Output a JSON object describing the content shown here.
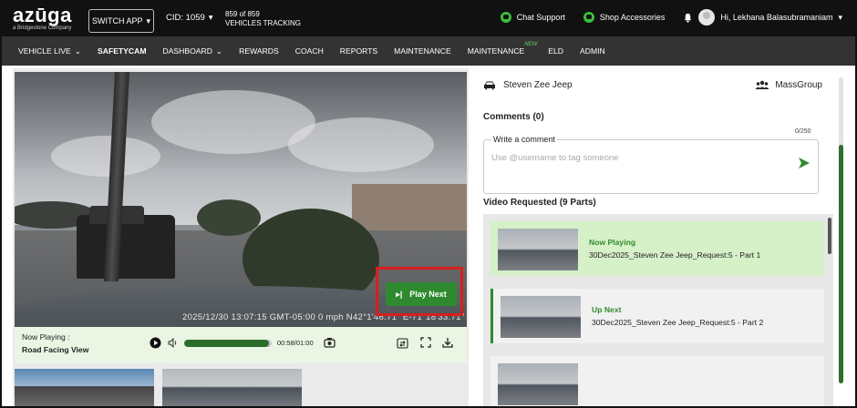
{
  "topbar": {
    "logo": "azūga",
    "logo_sub": "a Bridgestone Company",
    "switch_app": "SWITCH APP",
    "cid": "CID: 1059",
    "tracking_count": "859 of 859",
    "tracking_label": "VEHICLES TRACKING",
    "chat_support": "Chat Support",
    "shop_accessories": "Shop Accessories",
    "user_greeting": "Hi, Lekhana Balasubramaniam"
  },
  "nav": {
    "items": [
      {
        "label": "VEHICLE LIVE",
        "dropdown": true
      },
      {
        "label": "SAFETYCAM",
        "active": true
      },
      {
        "label": "DASHBOARD",
        "dropdown": true
      },
      {
        "label": "REWARDS"
      },
      {
        "label": "COACH"
      },
      {
        "label": "REPORTS"
      },
      {
        "label": "MAINTENANCE"
      },
      {
        "label": "MAINTENANCE",
        "badge": "NEW"
      },
      {
        "label": "ELD"
      },
      {
        "label": "ADMIN"
      }
    ]
  },
  "video": {
    "timestamp": "2025/12/30 13:07:15 GMT-05:00   0 mph   N42°1'46.71\"  E-71°18'33.71\"",
    "play_next": "Play Next",
    "now_playing_label": "Now Playing :",
    "now_playing_value": "Road Facing View",
    "time": "00:58/01:00",
    "progress": 0.97
  },
  "right": {
    "vehicle_name": "Steven Zee Jeep",
    "group_name": "MassGroup",
    "comments_title": "Comments (0)",
    "char_count": "0/250",
    "comment_legend": "Write a comment",
    "comment_placeholder": "Use @username to tag someone",
    "video_requested_title": "Video Requested (9 Parts)",
    "parts": [
      {
        "status": "Now Playing",
        "name": "30Dec2025_Steven Zee Jeep_Request:5 - Part 1"
      },
      {
        "status": "Up Next",
        "name": "30Dec2025_Steven Zee Jeep_Request:5 - Part 2"
      }
    ]
  },
  "colors": {
    "accent_green": "#2f8a2f",
    "highlight_red": "#d81e1e",
    "topbar_bg": "#111111",
    "navbar_bg": "#333333"
  }
}
